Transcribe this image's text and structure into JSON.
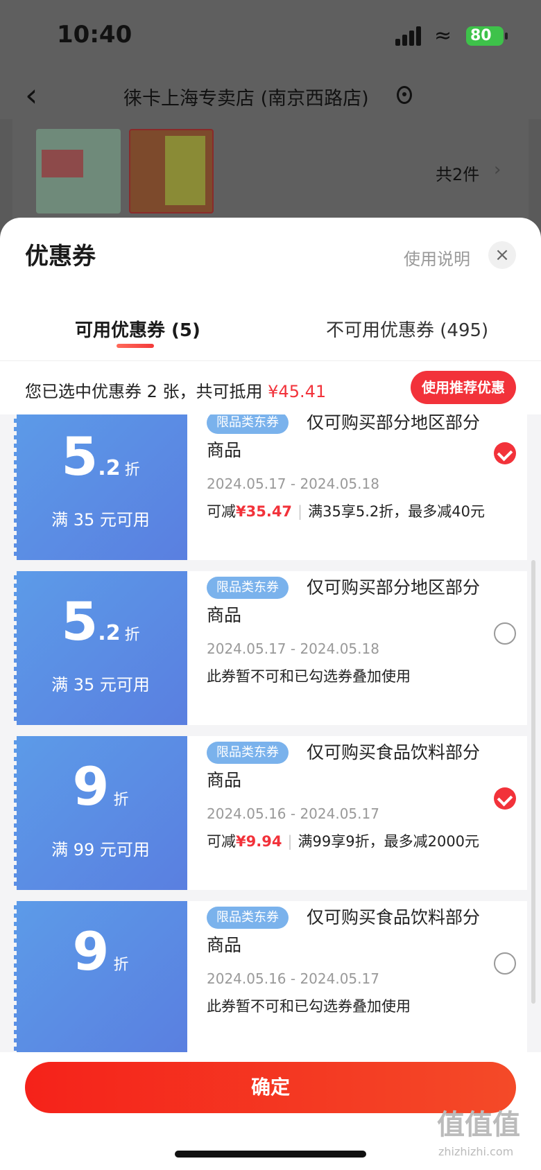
{
  "status": {
    "time": "10:40",
    "battery": "80"
  },
  "header": {
    "store_title": "徕卡上海专卖店 (南京西路店)",
    "item_count": "共2件"
  },
  "sheet": {
    "title": "优惠券",
    "usage_link": "使用说明",
    "tabs": [
      {
        "label": "可用优惠券 (5)",
        "active": true
      },
      {
        "label": "不可用优惠券 (495)",
        "active": false
      }
    ],
    "summary_prefix": "您已选中优惠券 2 张，共可抵用 ",
    "summary_amount": "¥45.41",
    "recommend_label": "使用推荐优惠"
  },
  "coupons": [
    {
      "big_num": "5",
      "big_dec": ".2",
      "unit": "折",
      "condition": "满 35 元可用",
      "tag": "限品类东券",
      "desc": "仅可购买部分地区部分商品",
      "date": "2024.05.17 - 2024.05.18",
      "note_prefix": "可减",
      "note_amount": "¥35.47",
      "note_rest": "满35享5.2折，最多减40元",
      "selected": true
    },
    {
      "big_num": "5",
      "big_dec": ".2",
      "unit": "折",
      "condition": "满 35 元可用",
      "tag": "限品类东券",
      "desc": "仅可购买部分地区部分商品",
      "date": "2024.05.17 - 2024.05.18",
      "note": "此券暂不可和已勾选券叠加使用",
      "selected": false
    },
    {
      "big_num": "9",
      "big_dec": "",
      "unit": "折",
      "condition": "满 99 元可用",
      "tag": "限品类东券",
      "desc": "仅可购买食品饮料部分商品",
      "date": "2024.05.16 - 2024.05.17",
      "note_prefix": "可减",
      "note_amount": "¥9.94",
      "note_rest": "满99享9折，最多减2000元",
      "selected": true
    },
    {
      "big_num": "9",
      "big_dec": "",
      "unit": "折",
      "condition": "",
      "tag": "限品类东券",
      "desc": "仅可购买食品饮料部分商品",
      "date": "2024.05.16 - 2024.05.17",
      "note": "此券暂不可和已勾选券叠加使用",
      "selected": false
    }
  ],
  "footer": {
    "confirm_label": "确定"
  },
  "watermark": {
    "text": "值值值",
    "url": "zhizhizhi.com"
  },
  "icons": {
    "back": "chevron-left-icon",
    "location": "location-pin-icon",
    "close": "close-icon",
    "check": "check-icon"
  },
  "colors": {
    "accent_red": "#f2323a",
    "coupon_blue": "#5c8ee6",
    "tag_blue": "#7ab2ec"
  }
}
